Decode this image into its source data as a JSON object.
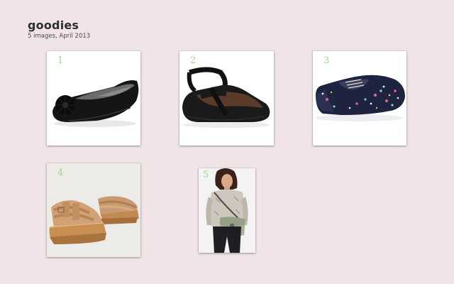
{
  "album": {
    "title": "goodies",
    "meta": "5 images, April 2013"
  },
  "images": [
    {
      "number": "1",
      "subject": "black ballet flat with pom-pom"
    },
    {
      "number": "2",
      "subject": "black ballet flat with elastic ankle straps"
    },
    {
      "number": "3",
      "subject": "navy floral print oxford flat"
    },
    {
      "number": "4",
      "subject": "tan leather wedge sandals"
    },
    {
      "number": "5",
      "subject": "woman carrying sage green shoulder bag"
    }
  ],
  "colors": {
    "background": "#f1e4e6",
    "number_accent": "#9ed889",
    "title_text": "#2e2e2e"
  }
}
